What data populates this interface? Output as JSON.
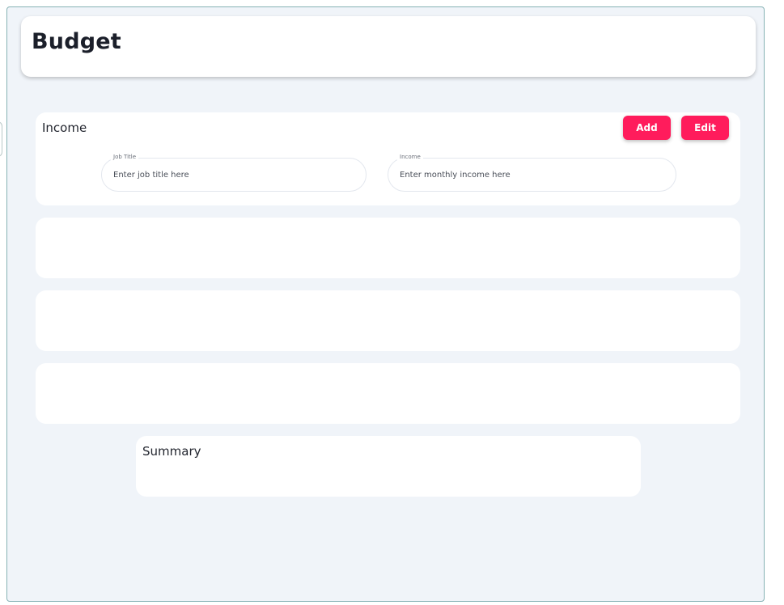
{
  "header": {
    "title": "Budget"
  },
  "income": {
    "title": "Income",
    "add_label": "Add",
    "edit_label": "Edit",
    "fields": {
      "job_title": {
        "label": "Job Title",
        "value": "",
        "placeholder": "Enter job title here"
      },
      "income": {
        "label": "Income",
        "value": "",
        "placeholder": "Enter monthly income here"
      }
    }
  },
  "summary": {
    "title": "Summary"
  },
  "colors": {
    "accent": "#ff1c5c",
    "background": "#f0f4f9",
    "card": "#ffffff",
    "frame_border": "#86b2b5"
  }
}
